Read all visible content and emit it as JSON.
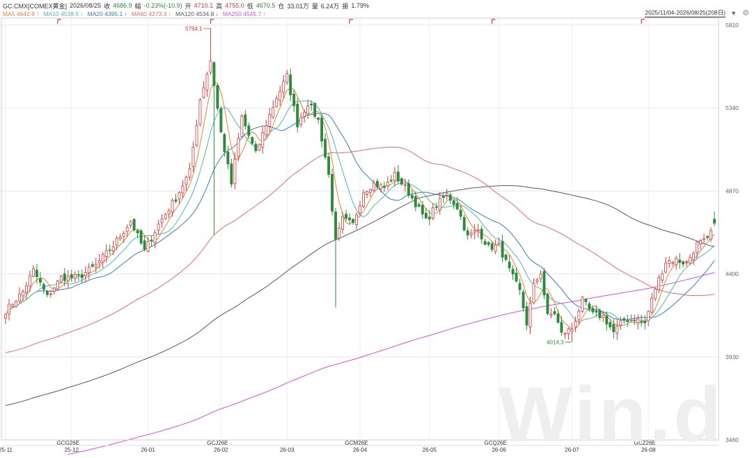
{
  "header": {
    "symbol": "GC.CMX[COMEX黄金]",
    "date": "2026/08/25",
    "close_label": "收",
    "close": "4686.9",
    "change_label": "幅",
    "change": "-0.23%(-10.9)",
    "open_label": "开",
    "open": "4710.1",
    "high_label": "高",
    "high": "4755.0",
    "low_label": "低",
    "low": "4670.5",
    "oi_label": "仓",
    "oi": "33.01万",
    "vol_label": "量",
    "vol": "6.24万",
    "amp_label": "振",
    "amp": "1.79%"
  },
  "ma_legend": [
    {
      "label": "MA5",
      "value": "4642.9",
      "arrow": "↑",
      "color": "#e8823a"
    },
    {
      "label": "MA10",
      "value": "4538.5",
      "arrow": "↑",
      "color": "#4fb6b0"
    },
    {
      "label": "MA20",
      "value": "4395.1",
      "arrow": "↑",
      "color": "#3b78c0"
    },
    {
      "label": "MA60",
      "value": "4273.3",
      "arrow": "↑",
      "color": "#e26a6a"
    },
    {
      "label": "MA120",
      "value": "4534.8",
      "arrow": "↓",
      "color": "#555566"
    },
    {
      "label": "MA250",
      "value": "4545.7",
      "arrow": "↑",
      "color": "#d64fd6"
    }
  ],
  "range_label": "2025/11/04-2026/08/25(208日)",
  "watermark": "Win.d",
  "chart_data": {
    "type": "candlestick",
    "ylim": [
      3460,
      5810
    ],
    "yticks": [
      5810,
      5340,
      4870,
      4400,
      3930,
      3460
    ],
    "month_ticks": [
      {
        "label": "25-11",
        "i": 0
      },
      {
        "label": "25-12",
        "i": 19
      },
      {
        "label": "26-01",
        "i": 41
      },
      {
        "label": "26-02",
        "i": 62
      },
      {
        "label": "26-03",
        "i": 81
      },
      {
        "label": "26-04",
        "i": 102
      },
      {
        "label": "26-05",
        "i": 122
      },
      {
        "label": "26-06",
        "i": 142
      },
      {
        "label": "26-07",
        "i": 163
      },
      {
        "label": "26-08",
        "i": 185
      }
    ],
    "contract_labels": [
      {
        "label": "GCG26E",
        "i": 18
      },
      {
        "label": "GCJ26E",
        "i": 61
      },
      {
        "label": "GCM26E",
        "i": 101
      },
      {
        "label": "GCQ26E",
        "i": 141
      },
      {
        "label": "GCZ26E",
        "i": 184
      }
    ],
    "roll_markers": [
      15,
      59,
      99,
      140,
      183
    ],
    "annotations": [
      {
        "text": "5794.1",
        "i": 59,
        "price": 5794.1,
        "pos": "top"
      },
      {
        "text": "4014.3",
        "i": 163,
        "price": 4014.3,
        "pos": "bottom"
      }
    ],
    "anchors": [
      [
        0,
        4190
      ],
      [
        5,
        4300
      ],
      [
        8,
        4420
      ],
      [
        12,
        4270
      ],
      [
        16,
        4380
      ],
      [
        21,
        4380
      ],
      [
        26,
        4450
      ],
      [
        31,
        4560
      ],
      [
        36,
        4700
      ],
      [
        40,
        4530
      ],
      [
        44,
        4680
      ],
      [
        49,
        4830
      ],
      [
        53,
        4980
      ],
      [
        56,
        5390
      ],
      [
        59,
        5610
      ],
      [
        62,
        5200
      ],
      [
        65,
        4910
      ],
      [
        68,
        5290
      ],
      [
        72,
        5080
      ],
      [
        75,
        5250
      ],
      [
        78,
        5400
      ],
      [
        81,
        5520
      ],
      [
        84,
        5250
      ],
      [
        87,
        5370
      ],
      [
        90,
        5270
      ],
      [
        93,
        4960
      ],
      [
        95,
        4580
      ],
      [
        97,
        4710
      ],
      [
        100,
        4680
      ],
      [
        103,
        4870
      ],
      [
        106,
        4910
      ],
      [
        109,
        4890
      ],
      [
        112,
        4960
      ],
      [
        115,
        4890
      ],
      [
        118,
        4800
      ],
      [
        121,
        4700
      ],
      [
        124,
        4790
      ],
      [
        127,
        4850
      ],
      [
        130,
        4780
      ],
      [
        133,
        4610
      ],
      [
        136,
        4650
      ],
      [
        139,
        4550
      ],
      [
        142,
        4560
      ],
      [
        145,
        4420
      ],
      [
        148,
        4300
      ],
      [
        150,
        4120
      ],
      [
        152,
        4330
      ],
      [
        154,
        4410
      ],
      [
        156,
        4160
      ],
      [
        158,
        4180
      ],
      [
        160,
        4060
      ],
      [
        163,
        4090
      ],
      [
        166,
        4250
      ],
      [
        169,
        4170
      ],
      [
        172,
        4160
      ],
      [
        175,
        4070
      ],
      [
        178,
        4140
      ],
      [
        181,
        4150
      ],
      [
        184,
        4120
      ],
      [
        187,
        4320
      ],
      [
        190,
        4470
      ],
      [
        193,
        4480
      ],
      [
        196,
        4460
      ],
      [
        199,
        4570
      ],
      [
        202,
        4590
      ],
      [
        204,
        4687
      ]
    ]
  }
}
